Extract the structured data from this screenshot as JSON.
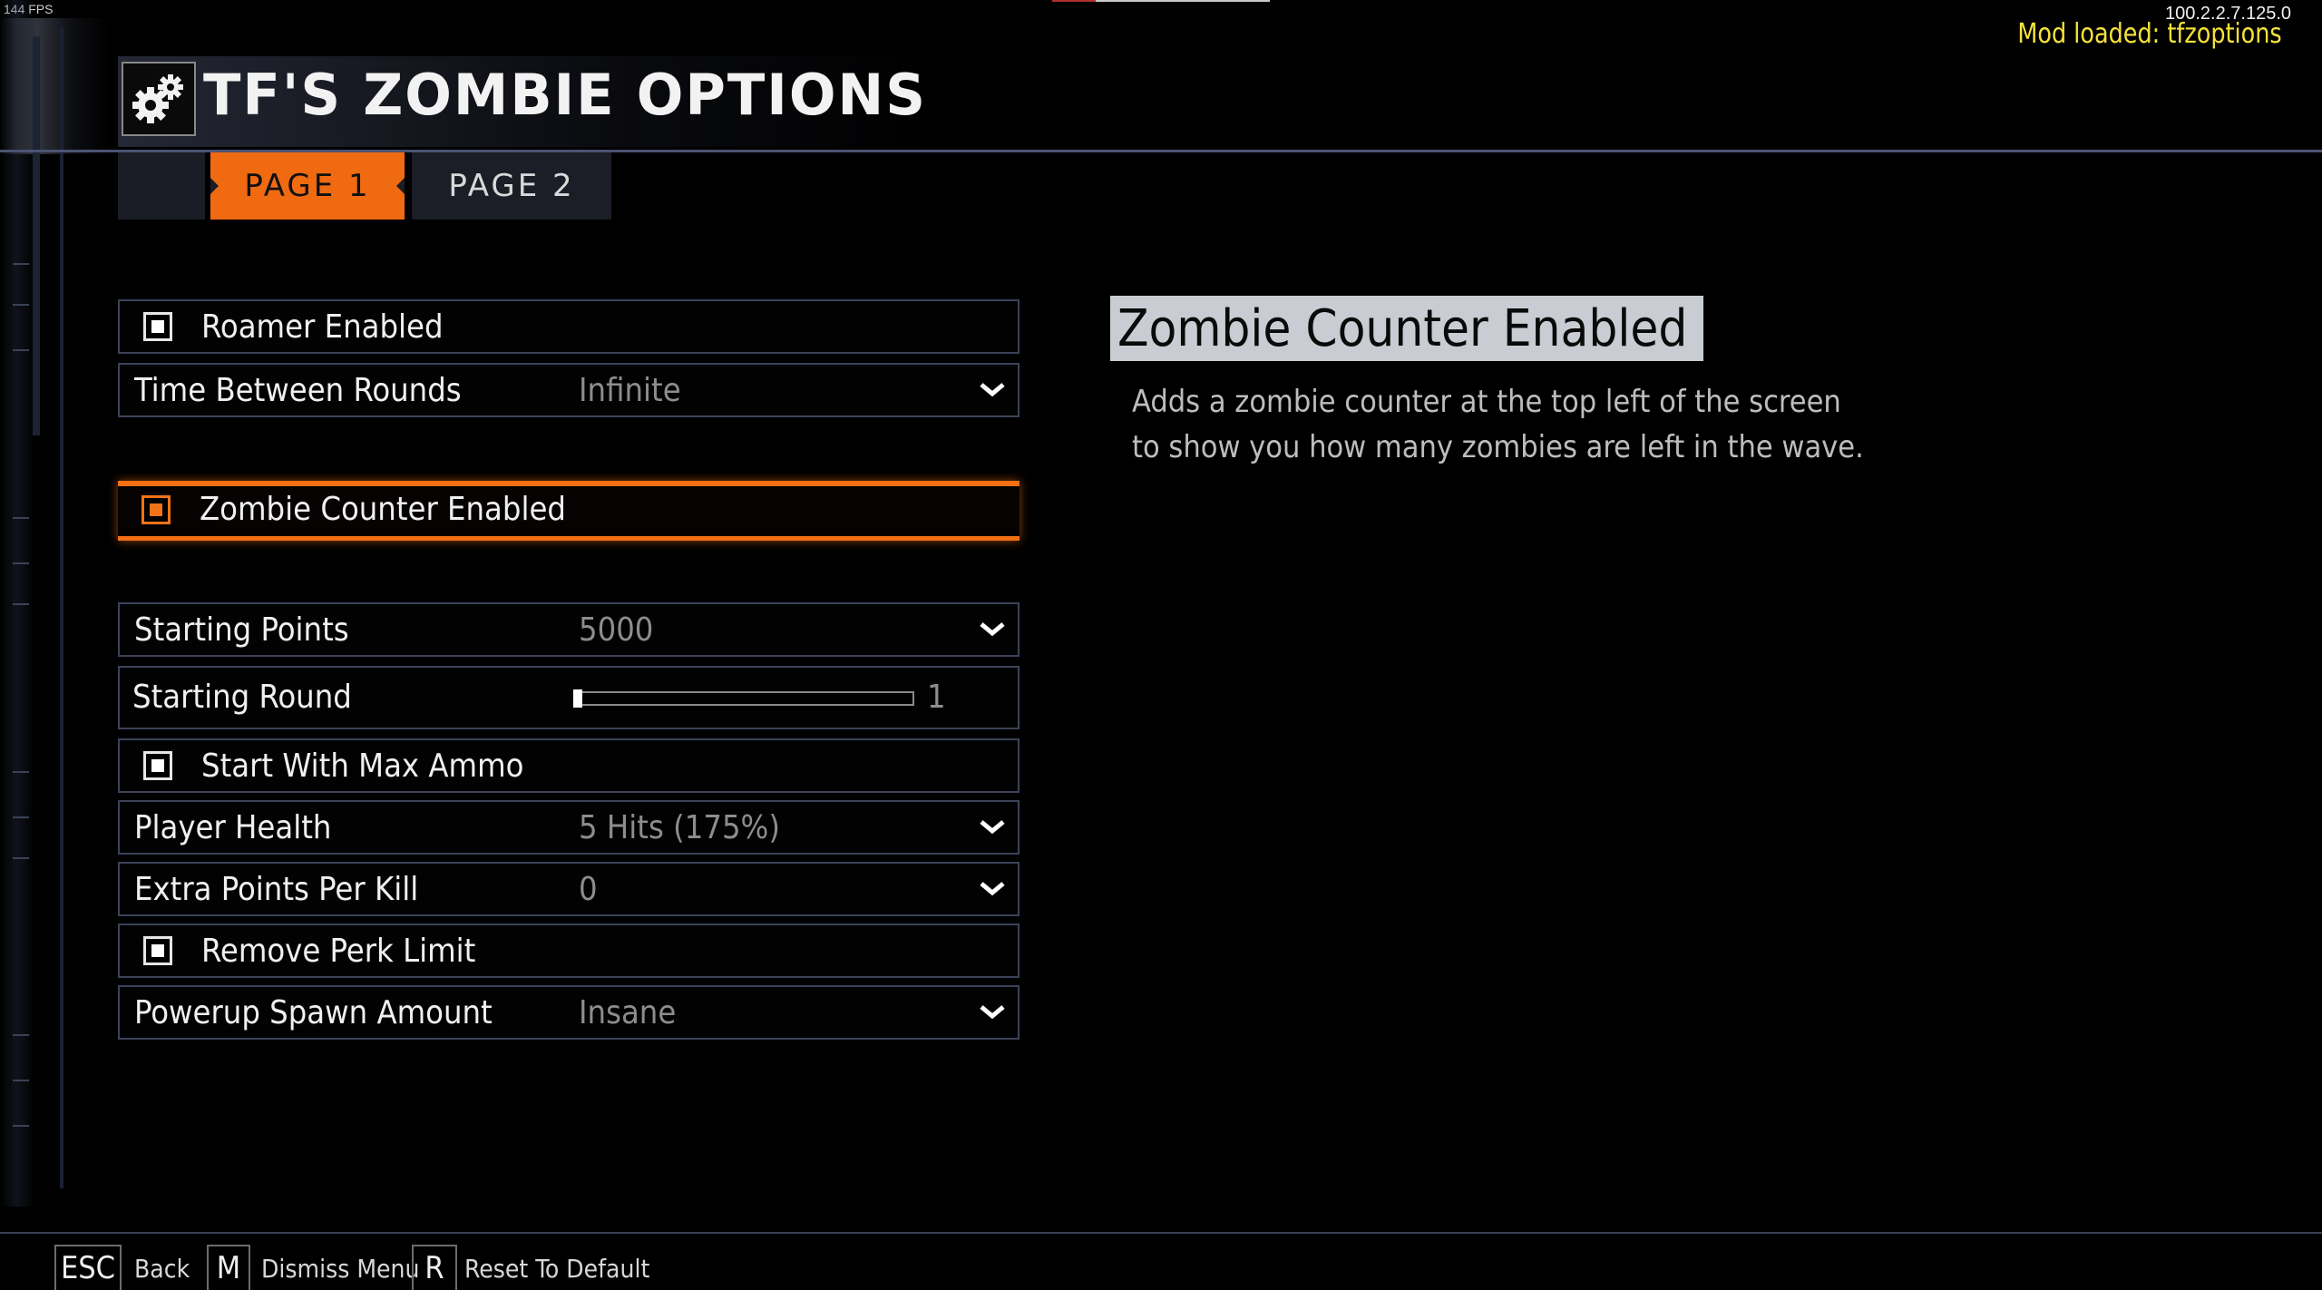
{
  "overlay": {
    "fps": "144 FPS",
    "version": "100.2.2.7.125.0",
    "mod_loaded": "Mod loaded: tfzoptions"
  },
  "header": {
    "title": "TF'S ZOMBIE OPTIONS",
    "icon": "gears-icon"
  },
  "tabs": [
    {
      "label": "PAGE 1",
      "active": true
    },
    {
      "label": "PAGE 2",
      "active": false
    }
  ],
  "options": {
    "roamer": {
      "label": "Roamer Enabled",
      "checked": true
    },
    "time_between_rounds": {
      "label": "Time Between Rounds",
      "value": "Infinite"
    },
    "zombie_counter": {
      "label": "Zombie Counter Enabled",
      "checked": true
    },
    "starting_points": {
      "label": "Starting Points",
      "value": "5000"
    },
    "starting_round": {
      "label": "Starting Round",
      "value": "1"
    },
    "max_ammo": {
      "label": "Start With Max Ammo",
      "checked": true
    },
    "player_health": {
      "label": "Player Health",
      "value": "5 Hits (175%)"
    },
    "extra_points": {
      "label": "Extra Points Per Kill",
      "value": "0"
    },
    "perk_limit": {
      "label": "Remove Perk Limit",
      "checked": true
    },
    "powerup_spawn": {
      "label": "Powerup Spawn Amount",
      "value": "Insane"
    }
  },
  "description": {
    "title": "Zombie Counter Enabled",
    "text": "Adds a zombie counter at the top left of the screen to show you how many zombies are left in the wave."
  },
  "footer": {
    "back": {
      "key": "ESC",
      "label": "Back"
    },
    "dismiss": {
      "key": "M",
      "label": "Dismiss Menu"
    },
    "reset": {
      "key": "R",
      "label": "Reset To Default"
    }
  },
  "colors": {
    "accent": "#f06a12",
    "mod_text": "#f5e33a",
    "frame": "#3c4358"
  }
}
